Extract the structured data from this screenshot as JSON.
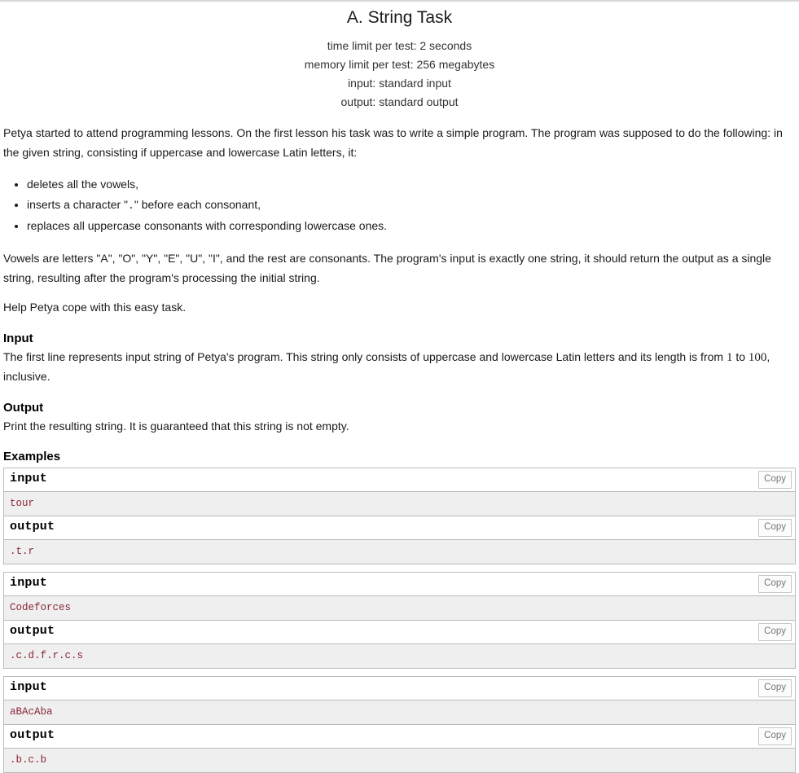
{
  "problem": {
    "title": "A. String Task",
    "limits": [
      "time limit per test: 2 seconds",
      "memory limit per test: 256 megabytes",
      "input: standard input",
      "output: standard output"
    ],
    "intro_paragraph": "Petya started to attend programming lessons. On the first lesson his task was to write a simple program. The program was supposed to do the following: in the given string, consisting if uppercase and lowercase Latin letters, it:",
    "rules": [
      {
        "before": "deletes all the vowels,",
        "code": "",
        "after": ""
      },
      {
        "before": "inserts a character \"",
        "code": ".",
        "after": "\" before each consonant,"
      },
      {
        "before": "replaces all uppercase consonants with corresponding lowercase ones.",
        "code": "",
        "after": ""
      }
    ],
    "vowels_paragraph": "Vowels are letters \"A\", \"O\", \"Y\", \"E\", \"U\", \"I\", and the rest are consonants. The program's input is exactly one string, it should return the output as a single string, resulting after the program's processing the initial string.",
    "help_paragraph": "Help Petya cope with this easy task.",
    "sections": {
      "input_title": "Input",
      "input_text_before": "The first line represents input string of Petya's program. This string only consists of uppercase and lowercase Latin letters and its length is from ",
      "input_num_low": "1",
      "input_text_mid": " to ",
      "input_num_high": "100",
      "input_text_after": ", inclusive.",
      "output_title": "Output",
      "output_text": "Print the resulting string. It is guaranteed that this string is not empty.",
      "examples_title": "Examples"
    },
    "io_labels": {
      "input": "input",
      "output": "output",
      "copy": "Copy"
    },
    "examples": [
      {
        "input": "tour",
        "output": ".t.r"
      },
      {
        "input": "Codeforces",
        "output": ".c.d.f.r.c.s"
      },
      {
        "input": "aBAcAba",
        "output": ".b.c.b"
      }
    ]
  },
  "colors": {
    "sample_text": "#8a2636",
    "sample_background": "#efefef",
    "border": "#bbbbbb",
    "copy_button_text": "#777777",
    "page_text": "#1a1a1a"
  }
}
